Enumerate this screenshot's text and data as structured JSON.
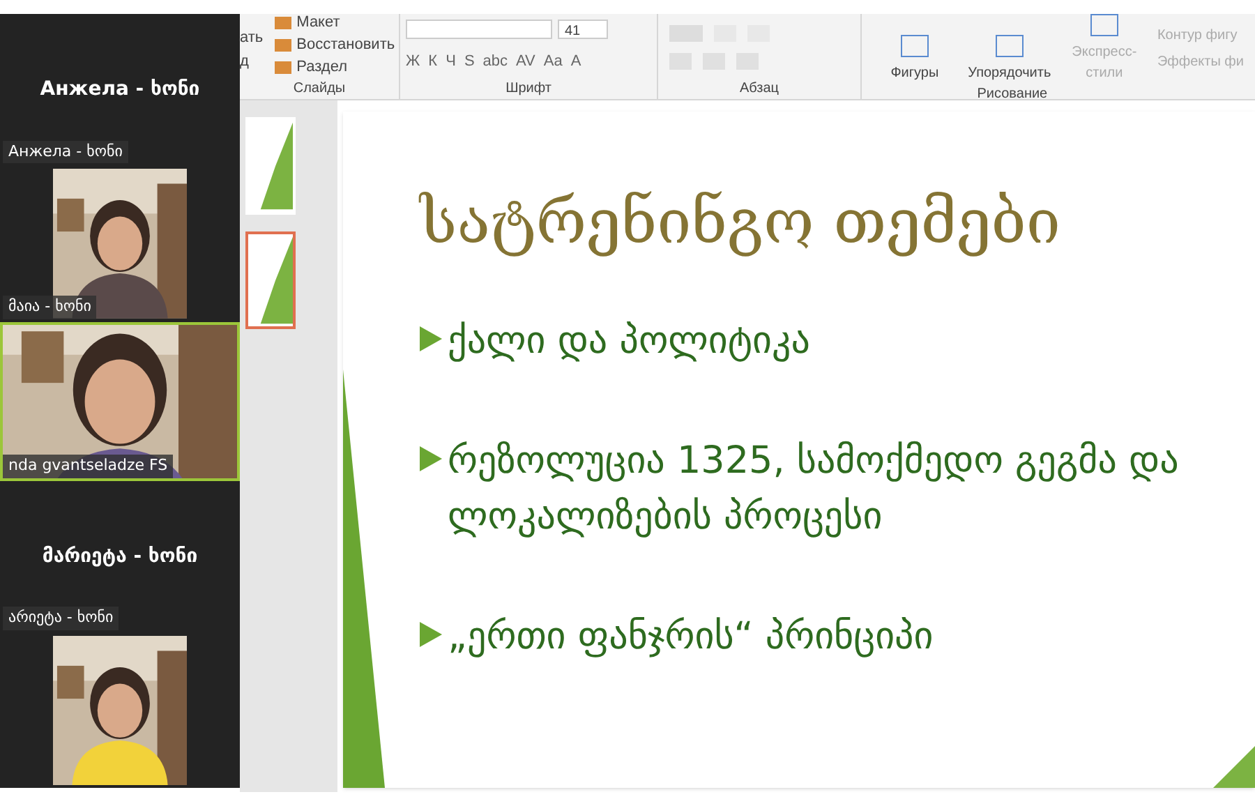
{
  "ribbon": {
    "groups": [
      {
        "label": "Слайды",
        "buttons": [
          "Макет",
          "Восстановить",
          "Раздел"
        ],
        "cut_labels": [
          "ать",
          "д"
        ]
      },
      {
        "label": "Шрифт",
        "font_size": "41",
        "format_buttons": [
          "Ж",
          "К",
          "Ч",
          "S",
          "abc",
          "AV",
          "Aa",
          "A"
        ]
      },
      {
        "label": "Абзац"
      },
      {
        "label": "Рисование",
        "buttons": [
          "Фигуры",
          "Упорядочить",
          "Экспресс-стили"
        ],
        "side_items": [
          "Контур фигу",
          "Эффекты фи"
        ]
      }
    ]
  },
  "zoom_tiles": [
    {
      "kind": "name_card",
      "heading": "Анжела - ხონი",
      "label": "Анжела - ხონი",
      "active": false
    },
    {
      "kind": "video",
      "label": "მაია - ხონი",
      "active": false
    },
    {
      "kind": "video",
      "label": "nda gvantseladze FS",
      "active": true
    },
    {
      "kind": "name_card",
      "heading": "მარიეტა - ხონი",
      "label": "არიეტა - ხონი",
      "active": false
    },
    {
      "kind": "video",
      "active": false
    }
  ],
  "thumbnails": [
    {
      "selected": false
    },
    {
      "selected": true
    }
  ],
  "slide": {
    "title": "სატრენინგო თემები",
    "bullets": [
      "ქალი და პოლიტიკა",
      "რეზოლუცია 1325, სამოქმედო გეგმა და ლოკალიზების პროცესი",
      "„ერთი ფანჯრის“ პრინციპი"
    ]
  }
}
